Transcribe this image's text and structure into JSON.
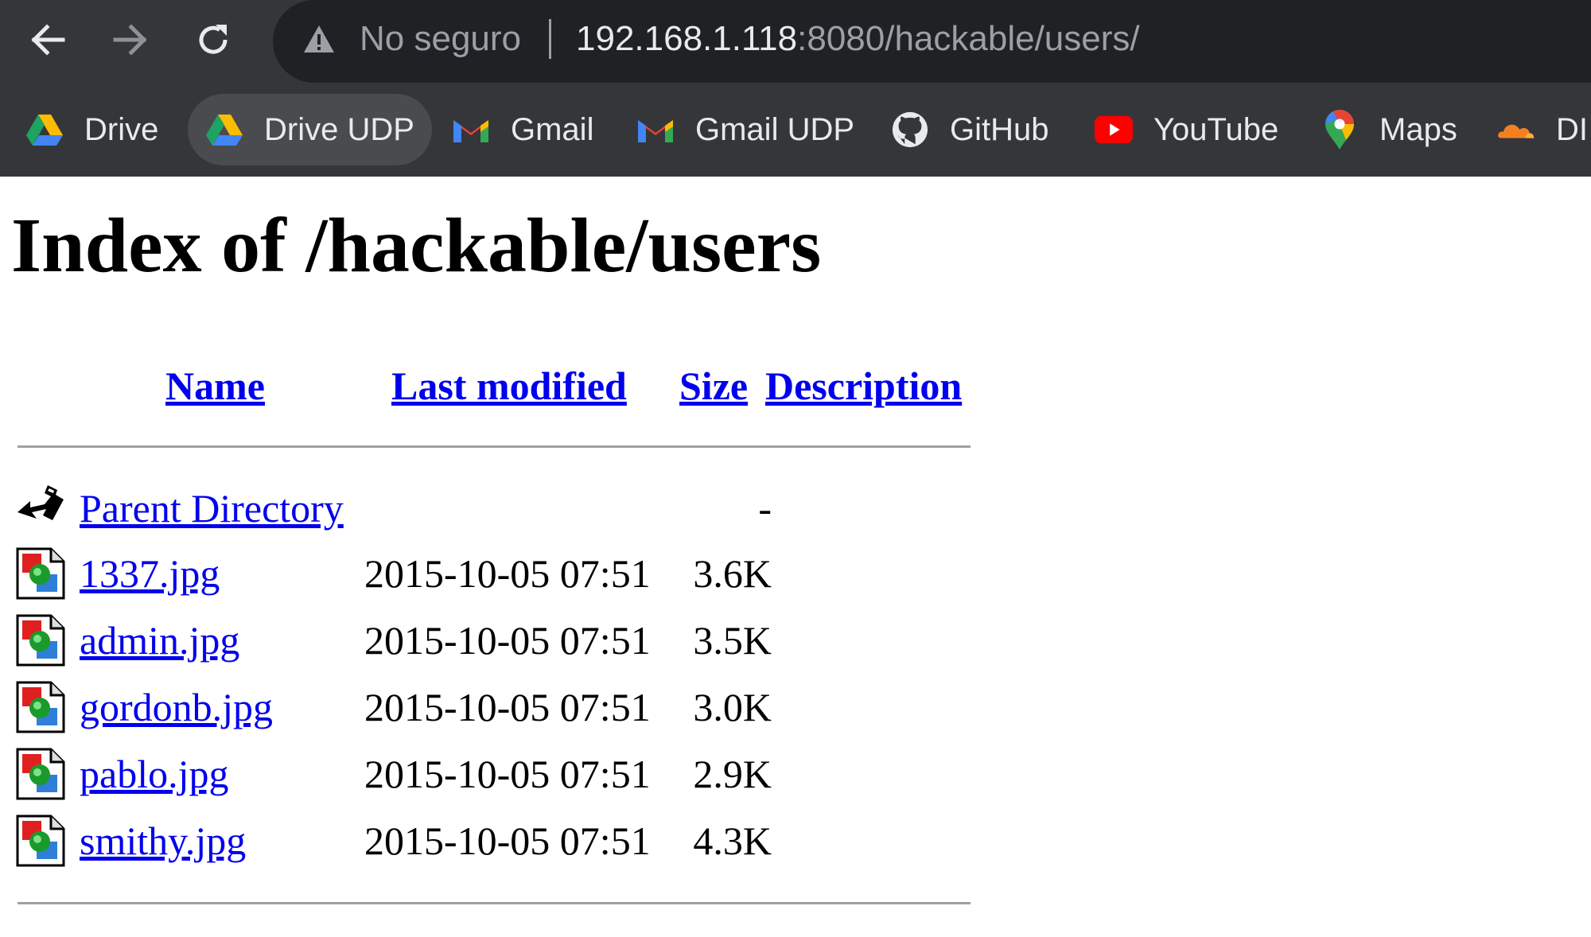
{
  "browser": {
    "security_label": "No seguro",
    "url_host": "192.168.1.118",
    "url_rest": ":8080/hackable/users/",
    "bookmarks": [
      {
        "label": "Drive",
        "icon": "google-drive-icon"
      },
      {
        "label": "Drive UDP",
        "icon": "google-drive-icon"
      },
      {
        "label": "Gmail",
        "icon": "gmail-icon"
      },
      {
        "label": "Gmail UDP",
        "icon": "gmail-icon"
      },
      {
        "label": "GitHub",
        "icon": "github-icon"
      },
      {
        "label": "YouTube",
        "icon": "youtube-icon"
      },
      {
        "label": "Maps",
        "icon": "google-maps-icon"
      },
      {
        "label": "DI",
        "icon": "cloudflare-icon"
      }
    ]
  },
  "page": {
    "title": "Index of /hackable/users",
    "columns": {
      "name": "Name",
      "last_modified": "Last modified",
      "size": "Size",
      "description": "Description"
    },
    "parent": {
      "name": "Parent Directory",
      "size": "-"
    },
    "files": [
      {
        "name": "1337.jpg",
        "modified": "2015-10-05 07:51",
        "size": "3.6K"
      },
      {
        "name": "admin.jpg",
        "modified": "2015-10-05 07:51",
        "size": "3.5K"
      },
      {
        "name": "gordonb.jpg",
        "modified": "2015-10-05 07:51",
        "size": "3.0K"
      },
      {
        "name": "pablo.jpg",
        "modified": "2015-10-05 07:51",
        "size": "2.9K"
      },
      {
        "name": "smithy.jpg",
        "modified": "2015-10-05 07:51",
        "size": "4.3K"
      }
    ]
  },
  "colors": {
    "chrome_bg": "#35363a",
    "omnibox_bg": "#202124",
    "link": "#0000ee",
    "rule": "#a0a0a0"
  }
}
